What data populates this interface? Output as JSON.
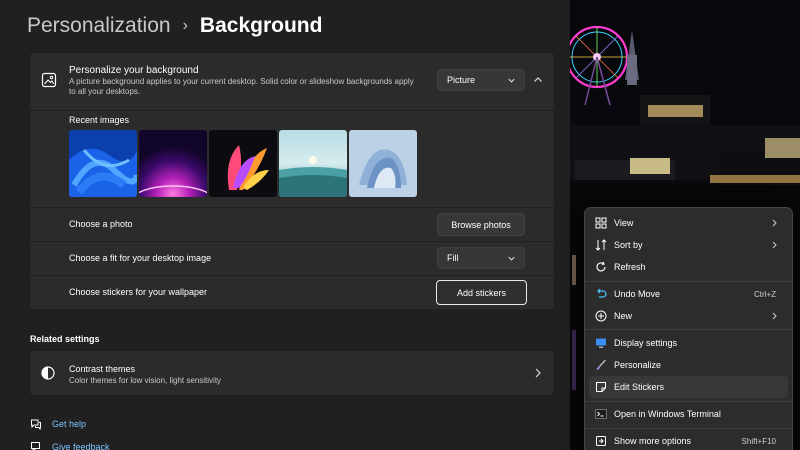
{
  "breadcrumb": {
    "parent": "Personalization",
    "separator": "›",
    "current": "Background"
  },
  "personalize": {
    "title": "Personalize your background",
    "description": "A picture background applies to your current desktop. Solid color or slideshow backgrounds apply to all your desktops.",
    "selected": "Picture"
  },
  "recent_images": {
    "label": "Recent images"
  },
  "choose_photo": {
    "label": "Choose a photo",
    "button": "Browse photos"
  },
  "choose_fit": {
    "label": "Choose a fit for your desktop image",
    "selected": "Fill"
  },
  "stickers": {
    "label": "Choose stickers for your wallpaper",
    "button": "Add stickers"
  },
  "related": {
    "title": "Related settings",
    "contrast_title": "Contrast themes",
    "contrast_desc": "Color themes for low vision, light sensitivity"
  },
  "links": {
    "help": "Get help",
    "feedback": "Give feedback"
  },
  "context_menu": {
    "view": "View",
    "sort_by": "Sort by",
    "refresh": "Refresh",
    "undo_move": "Undo Move",
    "undo_shortcut": "Ctrl+Z",
    "new": "New",
    "display_settings": "Display settings",
    "personalize": "Personalize",
    "edit_stickers": "Edit Stickers",
    "terminal": "Open in Windows Terminal",
    "more_options": "Show more options",
    "more_shortcut": "Shift+F10"
  },
  "colors": {
    "accent_link": "#7fc4ff",
    "panel_bg": "#202020",
    "card_bg": "#2b2b2b",
    "menu_bg": "#2c2c2c"
  }
}
